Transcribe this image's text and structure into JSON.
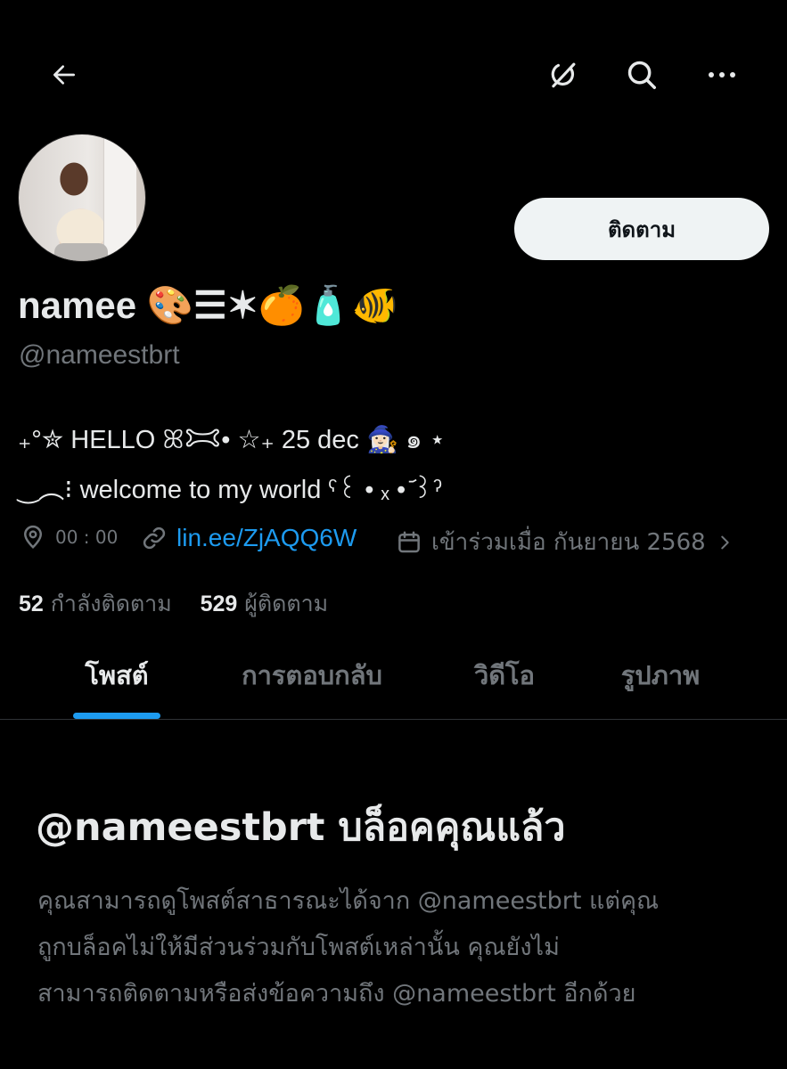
{
  "topbar": {
    "back_icon": "arrow-left-icon",
    "grok_icon": "grok-icon",
    "search_icon": "search-icon",
    "more_icon": "more-horizontal-icon"
  },
  "profile": {
    "display_name": "namee 🎨☰✶🍊🧴🐠",
    "handle": "@nameestbrt",
    "follow_label": "ติดตาม",
    "bio_line1": "₊°✮ HELLO ꕤ𐂯• ☆₊ 25 dec 🧙🏻‍♀️ ๑ ⋆",
    "bio_line2": "‿︵⁝ welcome to my world ˁ꒰ • ₓ • ᷄꒱ˀ",
    "location": "00 : 00",
    "link": "lin.ee/ZjAQQ6W",
    "joined": "เข้าร่วมเมื่อ กันยายน 2568"
  },
  "counts": {
    "following_num": "52",
    "following_label": "กำลังติดตาม",
    "followers_num": "529",
    "followers_label": "ผู้ติดตาม"
  },
  "tabs": [
    {
      "label": "โพสต์",
      "active": true
    },
    {
      "label": "การตอบกลับ",
      "active": false
    },
    {
      "label": "วิดีโอ",
      "active": false
    },
    {
      "label": "รูปภาพ",
      "active": false
    }
  ],
  "blocked": {
    "title": "@nameestbrt บล็อคคุณแล้ว",
    "line1": "คุณสามารถดูโพสต์สาธารณะได้จาก @nameestbrt แต่คุณ",
    "line2": "ถูกบล็อคไม่ให้มีส่วนร่วมกับโพสต์เหล่านั้น คุณยังไม่",
    "line3": "สามารถติดตามหรือส่งข้อความถึง @nameestbrt อีกด้วย"
  },
  "colors": {
    "background": "#000000",
    "text": "#e7e9ea",
    "muted": "#71767b",
    "accent": "#1d9bf0"
  }
}
